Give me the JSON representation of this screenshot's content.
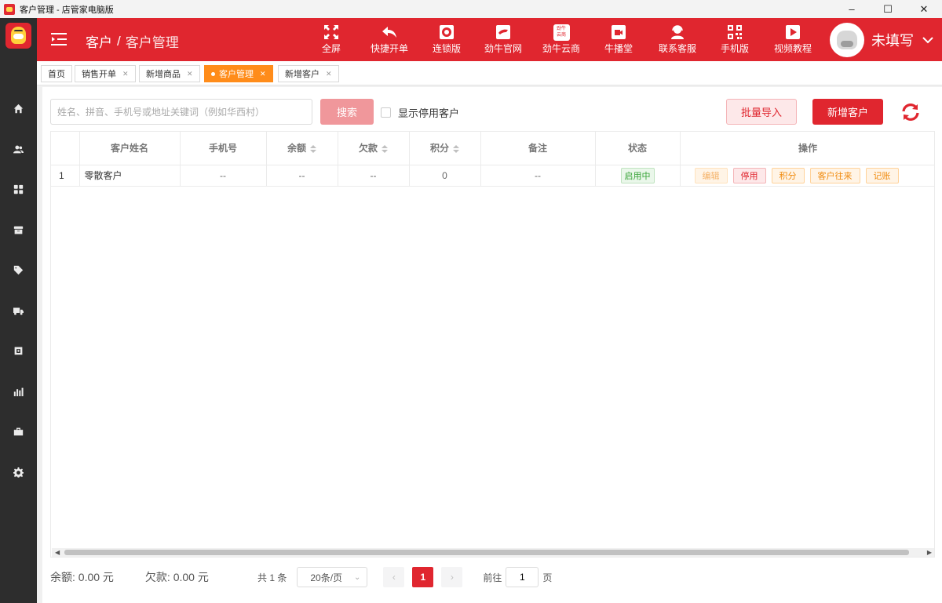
{
  "window": {
    "title": "客户管理 - 店管家电脑版",
    "controls": [
      "–",
      "☐",
      "✕"
    ]
  },
  "header": {
    "breadcrumb_parent": "客户",
    "breadcrumb_sep": "/",
    "breadcrumb_current": "客户管理",
    "tools": [
      {
        "label": "全屏",
        "icon": "fullscreen-icon"
      },
      {
        "label": "快捷开单",
        "icon": "reply-icon"
      },
      {
        "label": "连锁版",
        "icon": "chain-icon"
      },
      {
        "label": "劲牛官网",
        "icon": "website-icon"
      },
      {
        "label": "劲牛云商",
        "icon": "cloud-store-icon"
      },
      {
        "label": "牛播堂",
        "icon": "video-camera-icon"
      },
      {
        "label": "联系客服",
        "icon": "support-icon"
      },
      {
        "label": "手机版",
        "icon": "qrcode-icon"
      },
      {
        "label": "视频教程",
        "icon": "play-icon"
      }
    ],
    "cloud_store_badge": [
      "劲牛",
      "云商"
    ],
    "user_name": "未填写"
  },
  "tabs": [
    {
      "label": "首页",
      "closable": false,
      "active": false
    },
    {
      "label": "销售开单",
      "closable": true,
      "active": false
    },
    {
      "label": "新增商品",
      "closable": true,
      "active": false
    },
    {
      "label": "客户管理",
      "closable": true,
      "active": true
    },
    {
      "label": "新增客户",
      "closable": true,
      "active": false
    }
  ],
  "toolbar": {
    "search_placeholder": "姓名、拼音、手机号或地址关键词（例如华西村）",
    "search_value": "",
    "search_label": "搜索",
    "show_disabled_label": "显示停用客户",
    "import_label": "批量导入",
    "add_label": "新增客户"
  },
  "table": {
    "columns": [
      "客户姓名",
      "手机号",
      "余额",
      "欠款",
      "积分",
      "备注",
      "状态",
      "操作"
    ],
    "rows": [
      {
        "index": "1",
        "name": "零散客户",
        "phone": "--",
        "balance": "--",
        "debt": "--",
        "points": "0",
        "remark": "--",
        "status": "启用中",
        "actions": [
          "编辑",
          "停用",
          "积分",
          "客户往来",
          "记账"
        ]
      }
    ]
  },
  "footer": {
    "balance_label": "余额:",
    "balance_value": "0.00 元",
    "debt_label": "欠款:",
    "debt_value": "0.00 元",
    "total": "共 1 条",
    "page_size": "20条/页",
    "prev": "‹",
    "current_page": "1",
    "next": "›",
    "goto_prefix": "前往",
    "goto_value": "1",
    "goto_suffix": "页"
  },
  "colors": {
    "brand_red": "#e0262f",
    "active_tab": "#ff8c1a",
    "sidebar": "#2d2d2d"
  }
}
